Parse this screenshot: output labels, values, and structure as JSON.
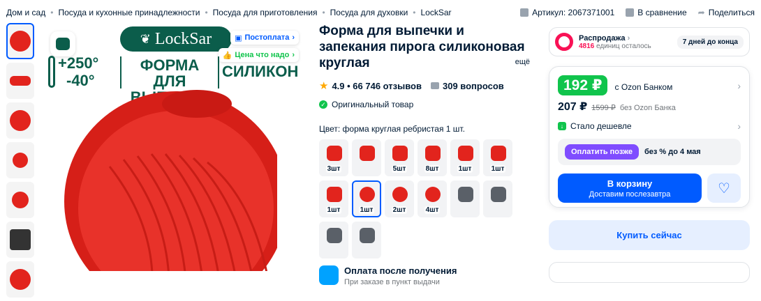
{
  "breadcrumbs": [
    "Дом и сад",
    "Посуда и кухонные принадлежности",
    "Посуда для приготовления",
    "Посуда для духовки",
    "LockSar"
  ],
  "header_actions": {
    "article": "Артикул: 2067371001",
    "compare": "В сравнение",
    "share": "Поделиться"
  },
  "hero": {
    "brand": "LockSar",
    "postpay_badge": "Постоплата",
    "good_price_badge": "Цена что надо",
    "temp_max": "+250°",
    "temp_min": "-40°",
    "line1": "ФОРМА ДЛЯ",
    "line2": "ВЫПЕЧКИ",
    "line3": "СИЛИКОН"
  },
  "product": {
    "title": "Форма для выпечки и запекания пирога силиконовая круглая",
    "more": "ещё",
    "rating": "4.9 • 66 746 отзывов",
    "questions": "309 вопросов",
    "original": "Оригинальный товар",
    "color_label": "Цвет: форма круглая ребристая 1 шт."
  },
  "swatches": [
    {
      "label": "3шт",
      "shape": "square",
      "color": "red"
    },
    {
      "label": "",
      "shape": "square",
      "color": "red"
    },
    {
      "label": "5шт",
      "shape": "square",
      "color": "red"
    },
    {
      "label": "8шт",
      "shape": "square",
      "color": "red"
    },
    {
      "label": "1шт",
      "shape": "square",
      "color": "red"
    },
    {
      "label": "1шт",
      "shape": "square",
      "color": "red"
    },
    {
      "label": "1шт",
      "shape": "square",
      "color": "red"
    },
    {
      "label": "1шт",
      "shape": "round",
      "color": "red",
      "selected": true
    },
    {
      "label": "2шт",
      "shape": "round",
      "color": "red"
    },
    {
      "label": "4шт",
      "shape": "round",
      "color": "red"
    },
    {
      "label": "",
      "shape": "square",
      "color": "gray"
    },
    {
      "label": "",
      "shape": "square",
      "color": "gray"
    },
    {
      "label": "",
      "shape": "square",
      "color": "gray"
    },
    {
      "label": "",
      "shape": "square",
      "color": "gray"
    }
  ],
  "pay_after": {
    "title": "Оплата после получения",
    "subtitle": "При заказе в пункт выдачи"
  },
  "sale": {
    "title": "Распродажа",
    "count": "4816",
    "count_suffix": "единиц осталось",
    "days": "7 дней до конца"
  },
  "buy": {
    "ozon_price": "192 ₽",
    "ozon_label": "с Ozon Банком",
    "price": "207 ₽",
    "old_price": "1599 ₽",
    "no_bank_label": "без Ozon Банка",
    "cheaper": "Стало дешевле",
    "later_button": "Оплатить позже",
    "later_text": "без % до 4 мая",
    "cart_title": "В корзину",
    "cart_sub": "Доставим послезавтра",
    "buy_now": "Купить сейчас"
  },
  "colors": {
    "accent": "#005bff",
    "green": "#10c44c",
    "red": "#e2241d",
    "pink": "#f91155",
    "purple": "#7f4cff"
  }
}
